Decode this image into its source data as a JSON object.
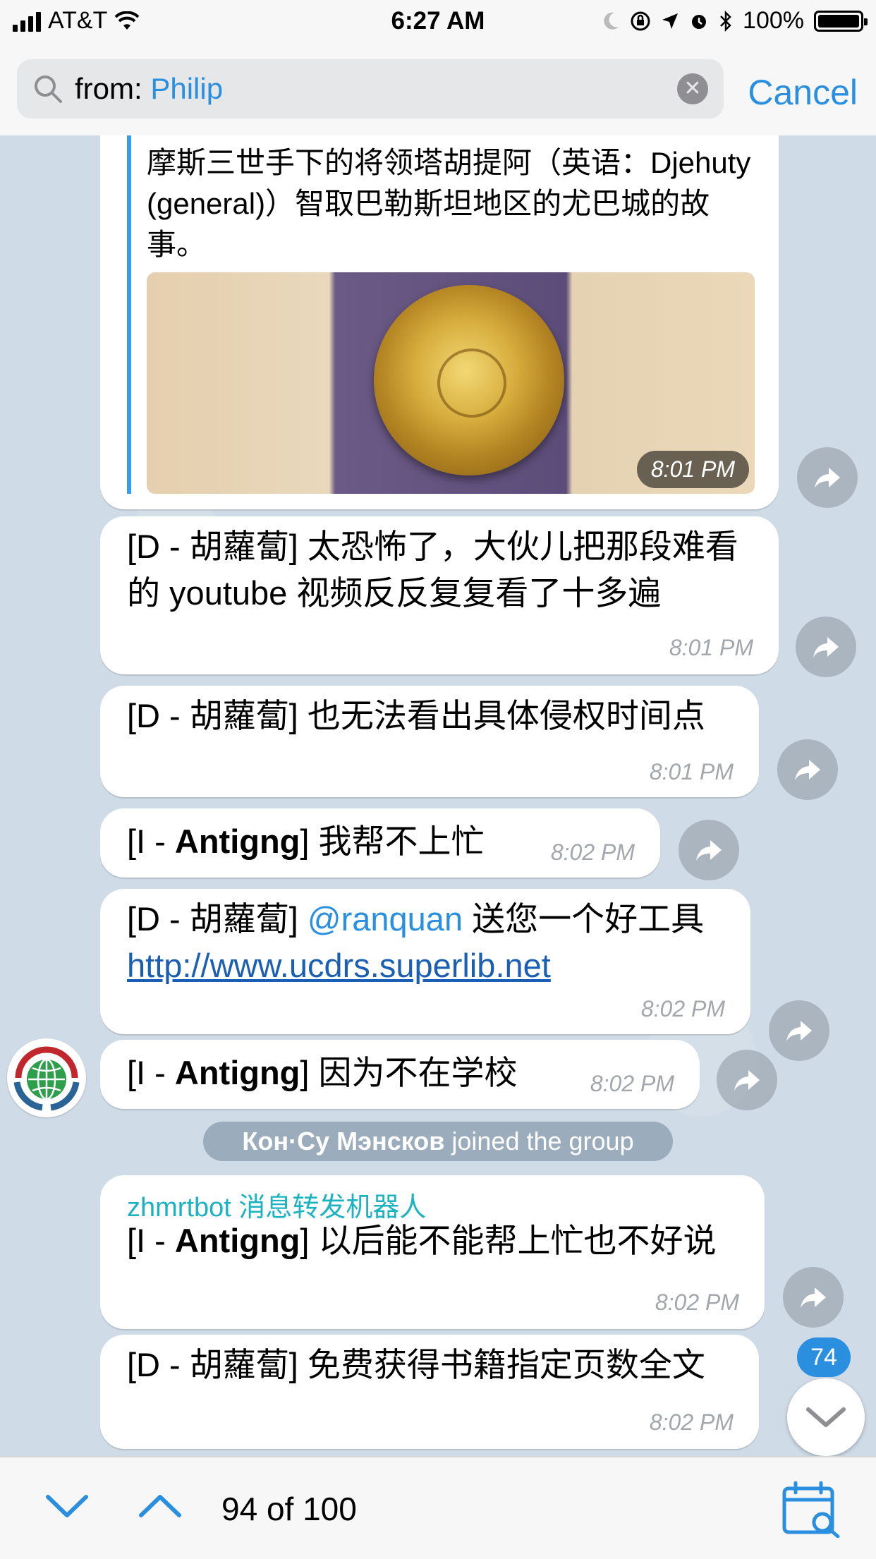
{
  "status_bar": {
    "carrier": "AT&T",
    "time": "6:27 AM",
    "battery": "100%"
  },
  "search": {
    "prefix": "from:",
    "value": "Philip",
    "cancel_label": "Cancel"
  },
  "messages": {
    "quoted": {
      "text": "摩斯三世手下的将领塔胡提阿（英语：Djehuty (general)）智取巴勒斯坦地区的尤巴城的故事。",
      "time": "8:01 PM"
    },
    "m1": {
      "tag": "[D - 胡蘿蔔]",
      "text": " 太恐怖了，大伙儿把那段难看的 youtube 视频反反复复看了十多遍",
      "time": "8:01 PM"
    },
    "m2": {
      "tag": "[D - 胡蘿蔔]",
      "text": " 也无法看出具体侵权时间点",
      "time": "8:01 PM"
    },
    "m3": {
      "tag_open": "[I - ",
      "tag_name": "Antigng",
      "tag_close": "]",
      "text": " 我帮不上忙",
      "time": "8:02 PM"
    },
    "m4": {
      "tag": "[D - 胡蘿蔔]",
      "mention": "@ranquan",
      "text": " 送您一个好工具 ",
      "link": "http://www.ucdrs.superlib.net",
      "time": "8:02 PM"
    },
    "m5": {
      "tag_open": "[I - ",
      "tag_name": "Antigng",
      "tag_close": "]",
      "text": " 因为不在学校",
      "time": "8:02 PM"
    },
    "system": {
      "name": "Кон·Су Мэнсков",
      "action": " joined the group"
    },
    "m6": {
      "sender": "zhmrtbot 消息转发机器人",
      "tag_open": "[I - ",
      "tag_name": "Antigng",
      "tag_close": "]",
      "text": " 以后能不能帮上忙也不好说",
      "time": "8:02 PM"
    },
    "m7": {
      "tag": "[D - 胡蘿蔔]",
      "text": " 免费获得书籍指定页数全文",
      "time": "8:02 PM"
    }
  },
  "unread_count": "74",
  "bottom_bar": {
    "counter": "94 of 100"
  },
  "icons": [
    "search-icon",
    "clear-icon",
    "forward-icon",
    "chevron-down-icon",
    "chevron-up-icon",
    "calendar-search-icon",
    "wifi-icon",
    "moon-icon",
    "location-icon",
    "alarm-icon",
    "bluetooth-icon",
    "lock-rotation-icon"
  ],
  "colors": {
    "accent": "#2b8fe0",
    "sender": "#1bb3c1",
    "chat_bg": "#cfdbe6"
  }
}
